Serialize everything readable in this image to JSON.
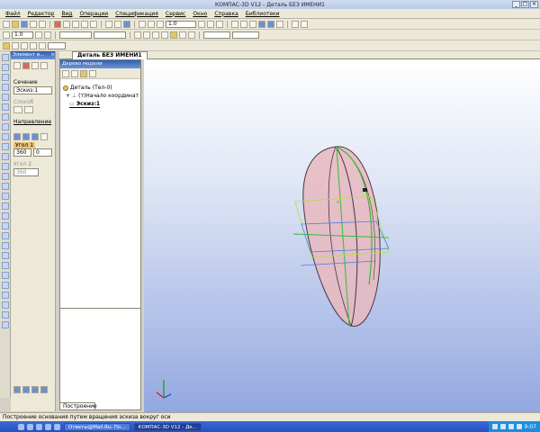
{
  "window": {
    "title": "КОМПАС-3D V12 - Деталь БЕЗ ИМЕНИ1",
    "controls": [
      "_",
      "□",
      "×"
    ]
  },
  "menu": [
    "Файл",
    "Редактор",
    "Вид",
    "Операции",
    "Спецификация",
    "Сервис",
    "Окно",
    "Справка",
    "Библиотеки"
  ],
  "toolbar": {
    "scale_value": "1.0",
    "step_value": "1.0"
  },
  "document_tab": "Деталь БЕЗ ИМЕНИ1",
  "properties": {
    "panel_title": "Элемент в...",
    "section_label": "Сечение",
    "section_value": "Эскиз:1",
    "contour_label": "Способ",
    "direction_label": "Направление",
    "angle_label": "Угол 1",
    "angle1_value": "360",
    "angle1_extra": "0",
    "angle2_label": "Угол 2",
    "angle2_value": "360"
  },
  "tree": {
    "panel_title": "Дерево модели",
    "items": [
      {
        "label": "Деталь (Тел-0)"
      },
      {
        "label": "(т)Начало координат"
      },
      {
        "label": "Эскиз:1"
      }
    ],
    "bottom_tab": "Построение"
  },
  "status": {
    "hint": "Построение основания путем вращения эскиза вокруг оси"
  },
  "taskbar": {
    "tasks": [
      "Ответы@Mail.Ru: По...",
      "КОМПАС-3D V12 - Де..."
    ],
    "clock": "9:07"
  },
  "colors": {
    "body_fill": "#e7b8c0",
    "sketch": "#30c030",
    "axis_blue": "#5080e0",
    "viewport_bottom": "#93a8e0"
  }
}
